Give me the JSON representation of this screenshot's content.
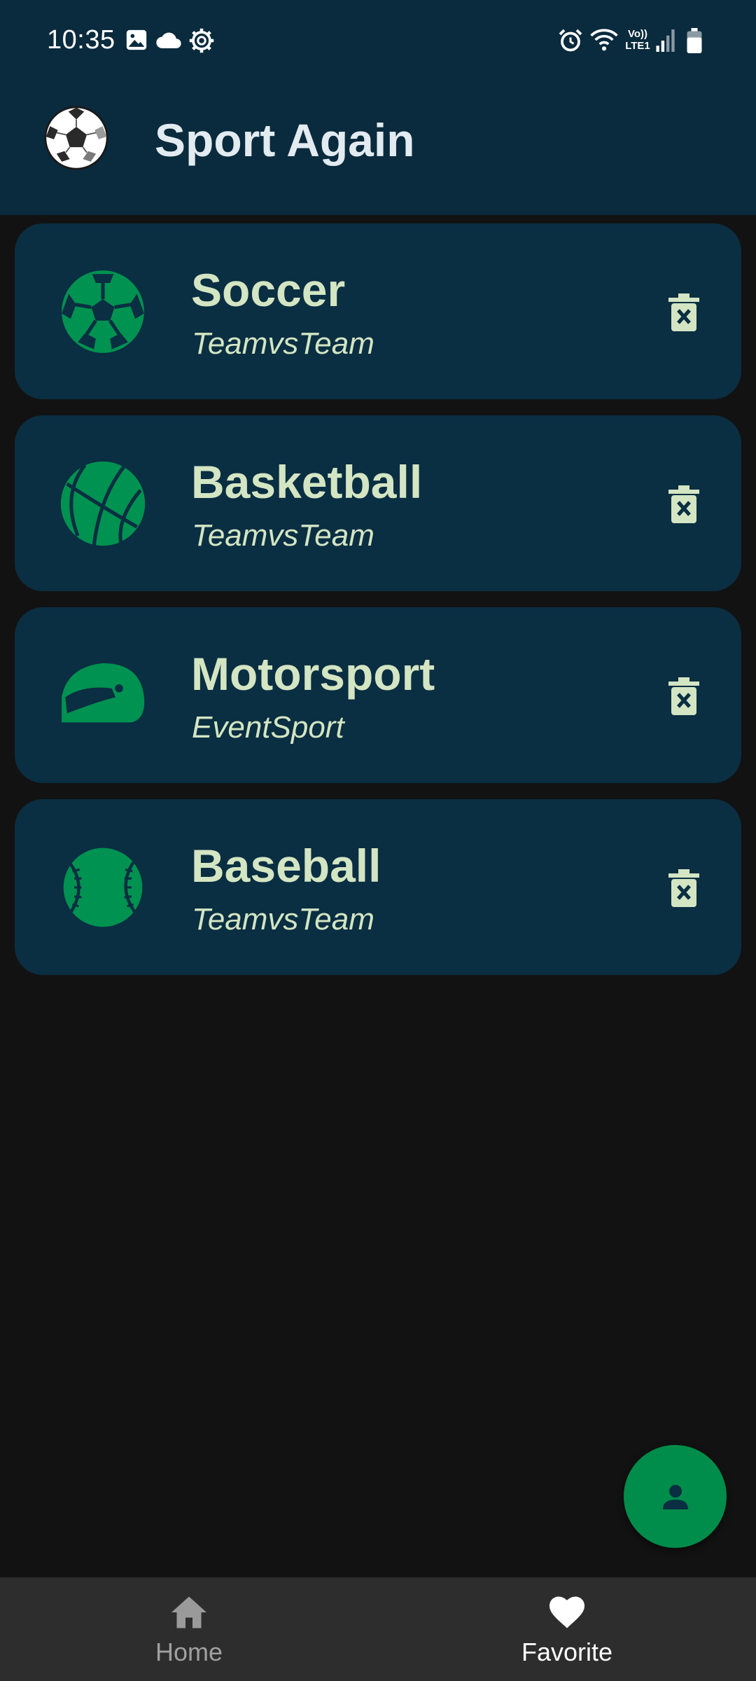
{
  "status_bar": {
    "time": "10:35",
    "network_label": [
      "Vo))",
      "LTE1"
    ],
    "left_icons": [
      "gallery-icon",
      "cloud-icon",
      "settings-gear-icon"
    ],
    "right_icons": [
      "alarm-icon",
      "wifi-icon",
      "signal-icon",
      "battery-icon"
    ]
  },
  "app_bar": {
    "title": "Sport Again",
    "logo_icon": "soccer-ball-logo"
  },
  "sports": [
    {
      "name": "Soccer",
      "type": "TeamvsTeam",
      "icon": "soccer-ball-icon"
    },
    {
      "name": "Basketball",
      "type": "TeamvsTeam",
      "icon": "basketball-icon"
    },
    {
      "name": "Motorsport",
      "type": "EventSport",
      "icon": "racing-helmet-icon"
    },
    {
      "name": "Baseball",
      "type": "TeamvsTeam",
      "icon": "baseball-icon"
    }
  ],
  "item_action_icon": "delete-icon",
  "fab": {
    "icon": "person-icon"
  },
  "bottom_nav": {
    "items": [
      {
        "label": "Home",
        "icon": "home-icon",
        "selected": false
      },
      {
        "label": "Favorite",
        "icon": "heart-icon",
        "selected": true
      }
    ]
  },
  "colors": {
    "app_bar_bg": "#0a2a3d",
    "card_bg": "#0a2e42",
    "card_text": "#d3e5c2",
    "accent_green": "#008c4a",
    "screen_bg": "#121212",
    "nav_bg": "#2d2d2d"
  }
}
